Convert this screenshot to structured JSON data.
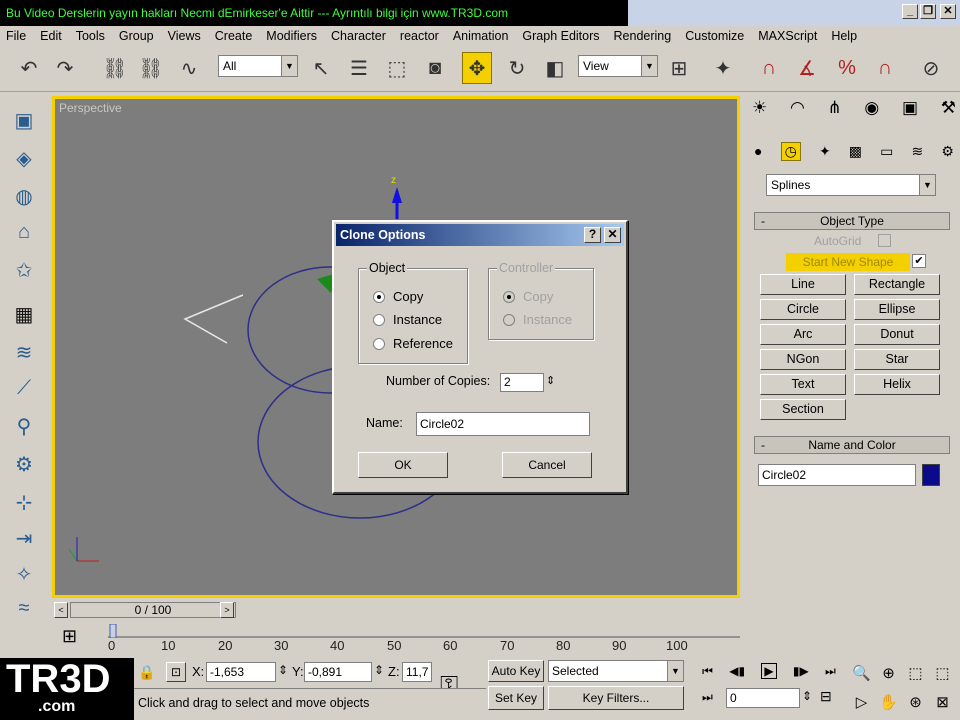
{
  "window": {
    "title": "Bu Video Derslerin yayın hakları Necmi dEmirkeser'e Aittir --- Ayrıntılı bilgi için www.TR3D.com",
    "controls": [
      "_",
      "❐",
      "✕"
    ]
  },
  "menu": [
    "File",
    "Edit",
    "Tools",
    "Group",
    "Views",
    "Create",
    "Modifiers",
    "Character",
    "reactor",
    "Animation",
    "Graph Editors",
    "Rendering",
    "Customize",
    "MAXScript",
    "Help"
  ],
  "toolbar": {
    "filter_value": "All",
    "coord_value": "View"
  },
  "viewport": {
    "label": "Perspective",
    "gizmo_z": "z"
  },
  "timeline": {
    "frame_label": "0 / 100",
    "ticks": [
      "0",
      "10",
      "20",
      "30",
      "40",
      "50",
      "60",
      "70",
      "80",
      "90",
      "100"
    ]
  },
  "status": {
    "logo": "TR3D",
    "logo_sub": ".com",
    "x_label": "X:",
    "x_value": "-1,653",
    "y_label": "Y:",
    "y_value": "-0,891",
    "z_label": "Z:",
    "z_value": "11,7",
    "prompt": "Click and drag to select and move objects",
    "auto_key": "Auto Key",
    "set_key": "Set Key",
    "selected_value": "Selected",
    "key_filters": "Key Filters...",
    "frame_value": "0"
  },
  "command_panel": {
    "category": "Splines",
    "object_type_header": "Object Type",
    "autogrid": "AutoGrid",
    "start_new_shape": "Start New Shape",
    "buttons": [
      "Line",
      "Rectangle",
      "Circle",
      "Ellipse",
      "Arc",
      "Donut",
      "NGon",
      "Star",
      "Text",
      "Helix",
      "Section"
    ],
    "name_color_header": "Name and Color",
    "name_value": "Circle02",
    "color": "#0a0a8a"
  },
  "dialog": {
    "title": "Clone Options",
    "help_btn": "?",
    "close_btn": "✕",
    "object_group": "Object",
    "object_options": [
      "Copy",
      "Instance",
      "Reference"
    ],
    "controller_group": "Controller",
    "controller_options": [
      "Copy",
      "Instance"
    ],
    "copies_label": "Number of Copies:",
    "copies_value": "2",
    "name_label": "Name:",
    "name_value": "Circle02",
    "ok": "OK",
    "cancel": "Cancel"
  }
}
